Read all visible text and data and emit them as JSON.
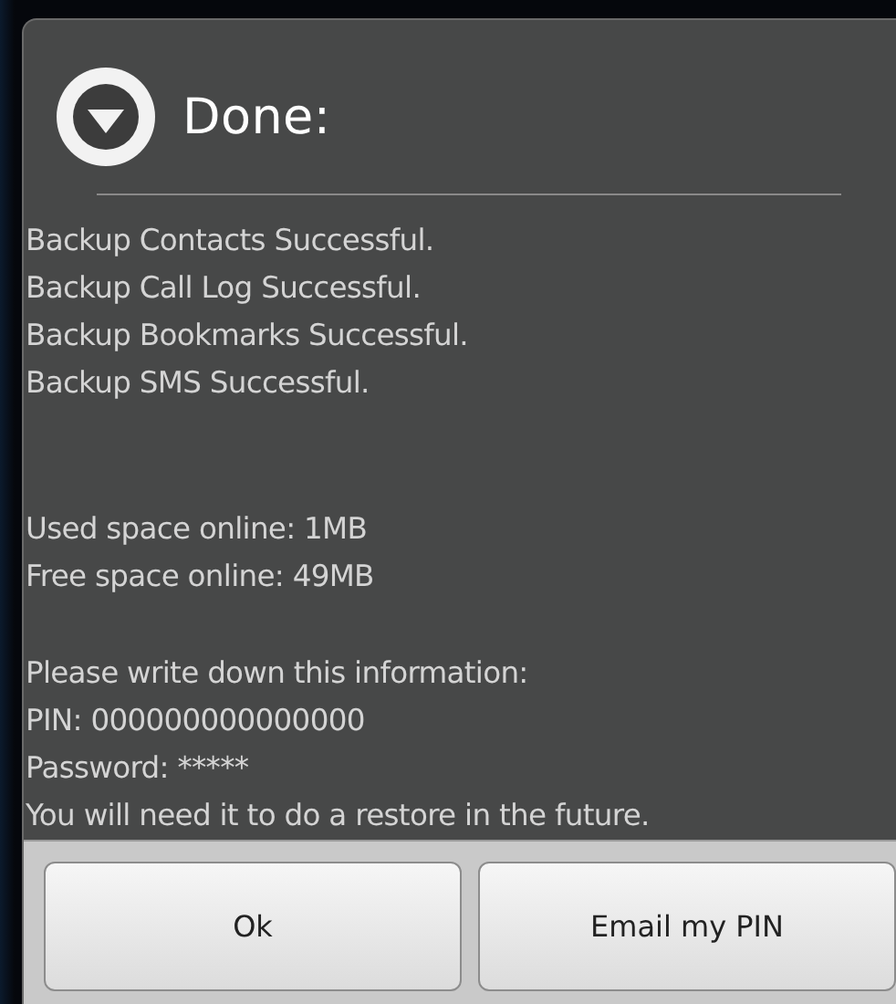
{
  "dialog": {
    "title": "Done:",
    "paragraphs": [
      [
        "Backup Contacts Successful.",
        "Backup Call Log Successful.",
        "Backup Bookmarks Successful.",
        "Backup SMS Successful."
      ],
      [
        "Used space online: 1MB",
        "Free space online: 49MB"
      ],
      [
        "Please write down this information:",
        "PIN: 000000000000000",
        "Password: *****",
        "You will need it to do a restore in the future."
      ]
    ],
    "buttons": [
      "Ok",
      "Email my PIN"
    ]
  }
}
